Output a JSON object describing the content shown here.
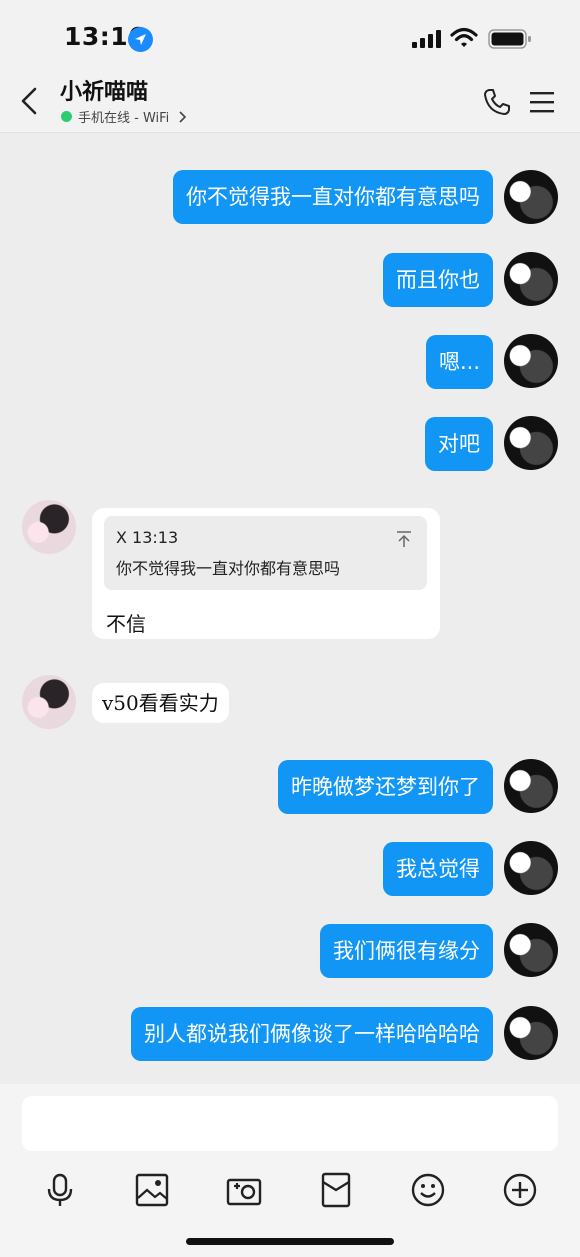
{
  "status_bar": {
    "time": "13:16"
  },
  "header": {
    "title": "小祈喵喵",
    "status": "手机在线 - WiFi"
  },
  "messages": [
    {
      "side": "out",
      "text": "你不觉得我一直对你都有意思吗"
    },
    {
      "side": "out",
      "text": "而且你也"
    },
    {
      "side": "out",
      "text": "嗯..."
    },
    {
      "side": "out",
      "text": "对吧"
    },
    {
      "side": "in",
      "quote_head": "X 13:13",
      "quote_text": "你不觉得我一直对你都有意思吗",
      "text": "不信"
    },
    {
      "side": "in",
      "text": "v50看看实力"
    },
    {
      "side": "out",
      "text": "昨晚做梦还梦到你了"
    },
    {
      "side": "out",
      "text": "我总觉得"
    },
    {
      "side": "out",
      "text": "我们俩很有缘分"
    },
    {
      "side": "out",
      "text": "别人都说我们俩像谈了一样哈哈哈哈"
    }
  ],
  "toolbar": [
    "mic-icon",
    "image-icon",
    "camera-icon",
    "red-packet-icon",
    "emoji-icon",
    "plus-icon"
  ],
  "colors": {
    "bubble_out": "#1296f5",
    "online": "#2ecc71",
    "background": "#ededed"
  }
}
